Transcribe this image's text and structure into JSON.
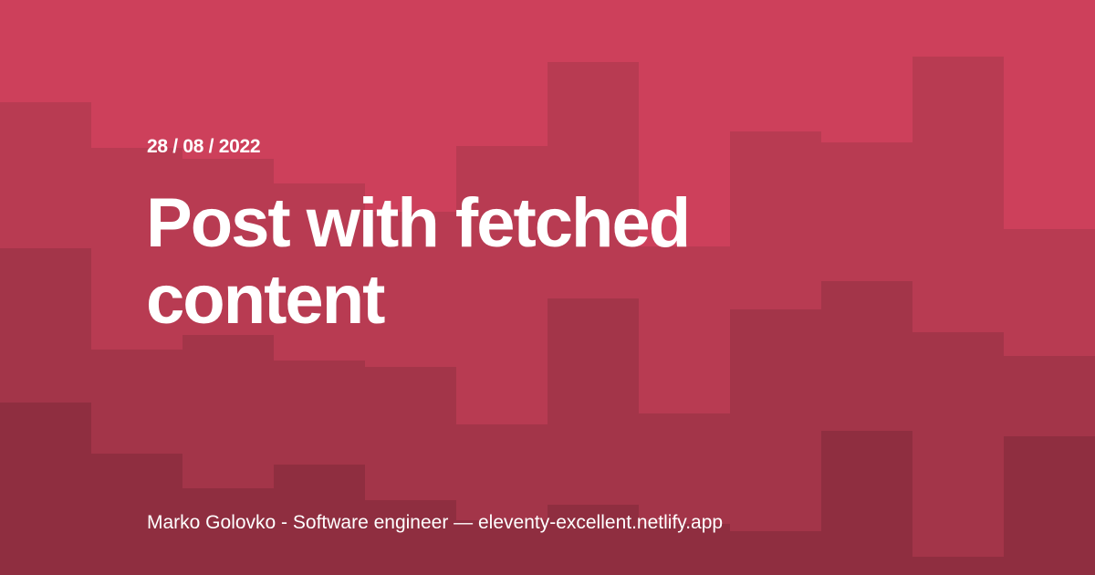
{
  "post": {
    "date": "28 / 08 / 2022",
    "title": "Post with fetched content"
  },
  "footer": {
    "text": "Marko Golovko - Software engineer — eleventy-excellent.netlify.app"
  },
  "colors": {
    "background": "#cd405b",
    "band_1": "#b83b52",
    "band_2": "#a33549",
    "band_3": "#8f2e40",
    "text": "#ffffff"
  }
}
